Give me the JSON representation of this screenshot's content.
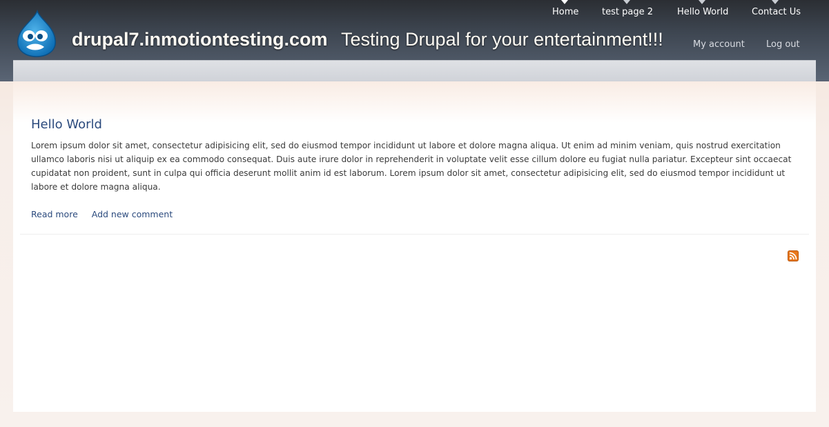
{
  "site": {
    "name": "drupal7.inmotiontesting.com",
    "slogan": "Testing Drupal for your entertainment!!!"
  },
  "main_menu": [
    {
      "label": "Home",
      "active": true
    },
    {
      "label": "test page 2",
      "active": false
    },
    {
      "label": "Hello World",
      "active": false
    },
    {
      "label": "Contact Us",
      "active": false
    }
  ],
  "secondary_menu": [
    {
      "label": "My account"
    },
    {
      "label": "Log out"
    }
  ],
  "node": {
    "title": "Hello World",
    "body": "Lorem ipsum dolor sit amet, consectetur adipisicing elit, sed do eiusmod tempor incididunt ut labore et dolore magna aliqua. Ut enim ad minim veniam, quis nostrud exercitation ullamco laboris nisi ut aliquip ex ea commodo consequat. Duis aute irure dolor in reprehenderit in voluptate velit esse cillum dolore eu fugiat nulla pariatur. Excepteur sint occaecat cupidatat non proident, sunt in culpa qui officia deserunt mollit anim id est laborum. Lorem ipsum dolor sit amet, consectetur adipisicing elit, sed do eiusmod tempor incididunt ut labore et dolore magna aliqua.",
    "links": {
      "read_more": "Read more",
      "add_comment": "Add new comment"
    }
  },
  "icons": {
    "logo": "drupal-drop-logo-icon",
    "feed": "rss-feed-icon"
  },
  "colors": {
    "link": "#2b4a7d",
    "header_dark": "#2b2e33",
    "rss": "#e8781c"
  }
}
